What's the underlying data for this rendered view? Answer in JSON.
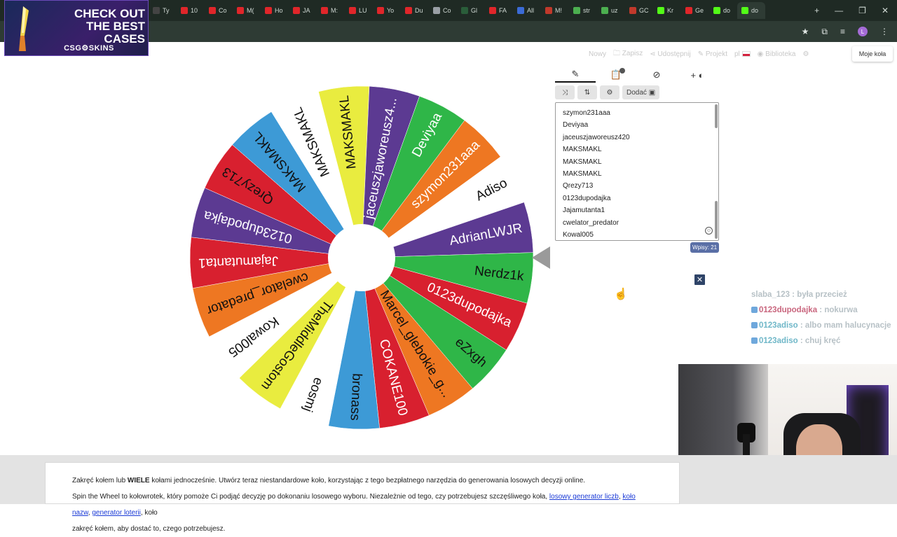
{
  "browser": {
    "tabs": [
      {
        "label": "Ty",
        "color": "#444444"
      },
      {
        "label": "10",
        "color": "#e0262a"
      },
      {
        "label": "Co",
        "color": "#e0262a"
      },
      {
        "label": "M(",
        "color": "#e0262a"
      },
      {
        "label": "Ho",
        "color": "#e0262a"
      },
      {
        "label": "JA",
        "color": "#e0262a"
      },
      {
        "label": "M:",
        "color": "#e0262a"
      },
      {
        "label": "LU",
        "color": "#e0262a"
      },
      {
        "label": "Yo",
        "color": "#e0262a"
      },
      {
        "label": "Du",
        "color": "#e0262a"
      },
      {
        "label": "Co",
        "color": "#9aa0a6"
      },
      {
        "label": "Gl",
        "color": "#2a5d3a"
      },
      {
        "label": "FA",
        "color": "#e0262a"
      },
      {
        "label": "All",
        "color": "#3b6bd6"
      },
      {
        "label": "M!",
        "color": "#c0392b"
      },
      {
        "label": "str",
        "color": "#4caf50"
      },
      {
        "label": "uz",
        "color": "#4caf50"
      },
      {
        "label": "GC",
        "color": "#c0392b"
      },
      {
        "label": "Kr",
        "color": "#53fc18"
      },
      {
        "label": "Ge",
        "color": "#e0262a"
      },
      {
        "label": "do",
        "color": "#53fc18"
      },
      {
        "label": "do",
        "color": "#53fc18"
      }
    ],
    "avatar_letter": "L"
  },
  "ad": {
    "line1": "CHECK OUT",
    "line2": "THE BEST",
    "line3": "CASES",
    "brand": "CSG⚙SKINS"
  },
  "nav": {
    "new": "Nowy",
    "save": "Zapisz",
    "share": "Udostępnij",
    "projects": "Projekt",
    "lang": "pl",
    "library": "Biblioteka",
    "my_wheels": "Moje koła"
  },
  "panel": {
    "add_label": "Dodać",
    "tab_badge": "",
    "entries": [
      "szymon231aaa",
      "Deviyaa",
      "jaceuszjaworeusz420",
      "MAKSMAKL",
      "MAKSMAKL",
      "MAKSMAKL",
      "Qrezy713",
      "0123dupodajka",
      "Jajamutanta1",
      "cwelator_predator",
      "Kowal005"
    ],
    "count_label": "Wpisy: 21"
  },
  "wheel": {
    "segments": [
      {
        "label": "MAKSMAKL",
        "color": "#e9ec3f",
        "text": "#111111"
      },
      {
        "label": "jaceuszjaworeusz4...",
        "color": "#5c3a92",
        "text": "#ffffff"
      },
      {
        "label": "Deviyaa",
        "color": "#2fb648",
        "text": "#ffffff"
      },
      {
        "label": "szymon231aaa",
        "color": "#ee7722",
        "text": "#ffffff"
      },
      {
        "label": "Adiso",
        "color": "#ffffff",
        "text": "#111111"
      },
      {
        "label": "AdrianLWJR",
        "color": "#5c3a92",
        "text": "#ffffff"
      },
      {
        "label": "Nerdz1k",
        "color": "#2fb648",
        "text": "#111111"
      },
      {
        "label": "0123dupodajka",
        "color": "#d8202f",
        "text": "#ffffff"
      },
      {
        "label": "eZxgh",
        "color": "#2fb648",
        "text": "#111111"
      },
      {
        "label": "Marcel_glebokie_g...",
        "color": "#ee7722",
        "text": "#111111"
      },
      {
        "label": "COKANE100",
        "color": "#d8202f",
        "text": "#ffffff"
      },
      {
        "label": "bronass",
        "color": "#3d9ad6",
        "text": "#111111"
      },
      {
        "label": "eosmj",
        "color": "#ffffff",
        "text": "#111111"
      },
      {
        "label": "TheMiddleGostom",
        "color": "#e9ec3f",
        "text": "#111111"
      },
      {
        "label": "Kowal005",
        "color": "#ffffff",
        "text": "#111111"
      },
      {
        "label": "cwelator_predator",
        "color": "#ee7722",
        "text": "#111111"
      },
      {
        "label": "Jajamutanta1",
        "color": "#d8202f",
        "text": "#ffffff"
      },
      {
        "label": "0123dupodajka",
        "color": "#5c3a92",
        "text": "#ffffff"
      },
      {
        "label": "Qrezy713",
        "color": "#d8202f",
        "text": "#111111"
      },
      {
        "label": "MAKSMAKL",
        "color": "#3d9ad6",
        "text": "#111111"
      },
      {
        "label": "MAKSMAKL",
        "color": "#ffffff",
        "text": "#111111"
      }
    ]
  },
  "chat": [
    {
      "nick": "",
      "msg": "slaba_123 : była przecież",
      "nick_color": "#c9667e"
    },
    {
      "nick": "0123dupodajka",
      "msg": ": nokurwa",
      "nick_color": "#c9667e"
    },
    {
      "nick": "0123adiso",
      "msg": ": albo mam halucynacje",
      "nick_color": "#6fb7c8"
    },
    {
      "nick": "0123adiso",
      "msg": ": chuj kręć",
      "nick_color": "#6fb7c8"
    }
  ],
  "footer": {
    "line1_a": "Zakręć kołem lub ",
    "line1_b": "WIELE",
    "line1_c": " kołami jednocześnie. Utwórz teraz niestandardowe koło, korzystając z tego bezpłatnego narzędzia do generowania losowych decyzji online.",
    "line2_a": "Spin the Wheel to kołowrotek, który pomoże Ci podjąć decyzję po dokonaniu losowego wyboru. Niezależnie od tego, czy potrzebujesz szczęśliwego koła, ",
    "link1": "losowy generator liczb",
    "sep1": ", ",
    "link2": "koło nazw",
    "sep2": ", ",
    "link3": "generator loterii",
    "line2_b": ", koło",
    "line3": "zakręć kołem, aby dostać to, czego potrzebujesz."
  }
}
